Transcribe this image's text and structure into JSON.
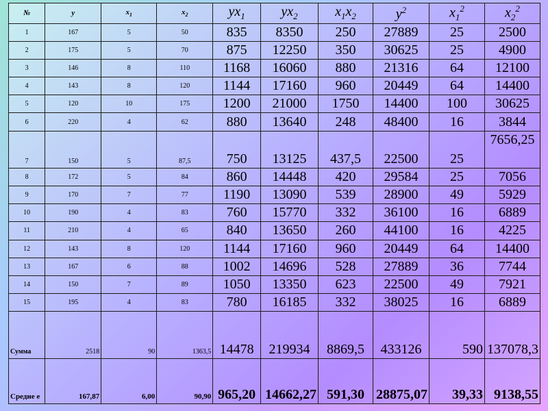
{
  "headers": [
    "№",
    "y",
    "x1",
    "x2",
    "yx1",
    "yx2",
    "x1x2",
    "y2",
    "x1 2",
    "x2 2"
  ],
  "rows": [
    [
      "1",
      "167",
      "5",
      "50",
      "835",
      "8350",
      "250",
      "27889",
      "25",
      "2500"
    ],
    [
      "2",
      "175",
      "5",
      "70",
      "875",
      "12250",
      "350",
      "30625",
      "25",
      "4900"
    ],
    [
      "3",
      "146",
      "8",
      "110",
      "1168",
      "16060",
      "880",
      "21316",
      "64",
      "12100"
    ],
    [
      "4",
      "143",
      "8",
      "120",
      "1144",
      "17160",
      "960",
      "20449",
      "64",
      "14400"
    ],
    [
      "5",
      "120",
      "10",
      "175",
      "1200",
      "21000",
      "1750",
      "14400",
      "100",
      "30625"
    ],
    [
      "6",
      "220",
      "4",
      "62",
      "880",
      "13640",
      "248",
      "48400",
      "16",
      "3844"
    ],
    [
      "7",
      "150",
      "5",
      "87,5",
      "750",
      "13125",
      "437,5",
      "22500",
      "25",
      "7656,25"
    ],
    [
      "8",
      "172",
      "5",
      "84",
      "860",
      "14448",
      "420",
      "29584",
      "25",
      "7056"
    ],
    [
      "9",
      "170",
      "7",
      "77",
      "1190",
      "13090",
      "539",
      "28900",
      "49",
      "5929"
    ],
    [
      "10",
      "190",
      "4",
      "83",
      "760",
      "15770",
      "332",
      "36100",
      "16",
      "6889"
    ],
    [
      "11",
      "210",
      "4",
      "65",
      "840",
      "13650",
      "260",
      "44100",
      "16",
      "4225"
    ],
    [
      "12",
      "143",
      "8",
      "120",
      "1144",
      "17160",
      "960",
      "20449",
      "64",
      "14400"
    ],
    [
      "13",
      "167",
      "6",
      "88",
      "1002",
      "14696",
      "528",
      "27889",
      "36",
      "7744"
    ],
    [
      "14",
      "150",
      "7",
      "89",
      "1050",
      "13350",
      "623",
      "22500",
      "49",
      "7921"
    ],
    [
      "15",
      "195",
      "4",
      "83",
      "780",
      "16185",
      "332",
      "38025",
      "16",
      "6889"
    ]
  ],
  "sum_row": [
    "Сумма",
    "2518",
    "90",
    "1363,5",
    "14478",
    "219934",
    "8869,5",
    "433126",
    "590",
    "137078,3"
  ],
  "avg_row": [
    "Средне е",
    "167,87",
    "6,00",
    "90,90",
    "965,20",
    "14662,27",
    "591,30",
    "28875,07",
    "39,33",
    "9138,55"
  ]
}
